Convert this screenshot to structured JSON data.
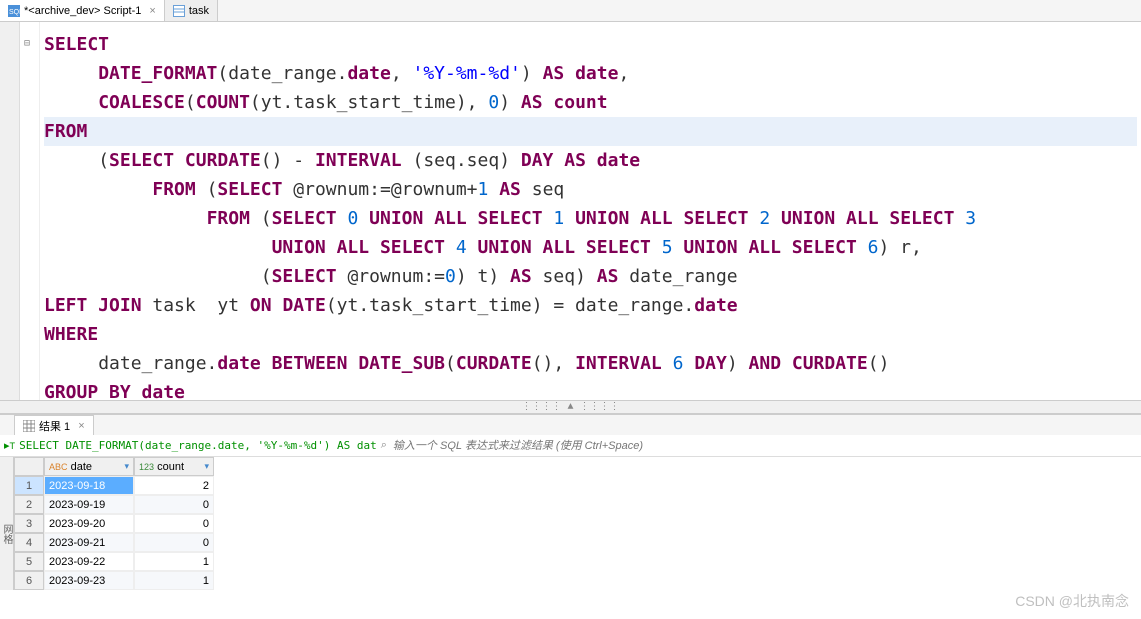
{
  "tabs": [
    {
      "label": "*<archive_dev> Script-1",
      "icon": "sql-icon",
      "active": true
    },
    {
      "label": "task",
      "icon": "table-icon",
      "active": false
    }
  ],
  "code": {
    "lines": [
      [
        {
          "c": "fold",
          "t": "⊟"
        },
        {
          "c": "kw",
          "t": "SELECT"
        }
      ],
      [
        {
          "c": "pad",
          "t": "     "
        },
        {
          "c": "kw",
          "t": "DATE_FORMAT"
        },
        {
          "c": "op",
          "t": "(date_range."
        },
        {
          "c": "kw",
          "t": "date"
        },
        {
          "c": "op",
          "t": ", "
        },
        {
          "c": "str",
          "t": "'%Y-%m-%d'"
        },
        {
          "c": "op",
          "t": ") "
        },
        {
          "c": "kw",
          "t": "AS"
        },
        {
          "c": "op",
          "t": " "
        },
        {
          "c": "kw",
          "t": "date"
        },
        {
          "c": "op",
          "t": ","
        }
      ],
      [
        {
          "c": "pad",
          "t": "     "
        },
        {
          "c": "kw",
          "t": "COALESCE"
        },
        {
          "c": "op",
          "t": "("
        },
        {
          "c": "kw",
          "t": "COUNT"
        },
        {
          "c": "op",
          "t": "(yt.task_start_time), "
        },
        {
          "c": "num",
          "t": "0"
        },
        {
          "c": "op",
          "t": ") "
        },
        {
          "c": "kw",
          "t": "AS"
        },
        {
          "c": "op",
          "t": " "
        },
        {
          "c": "kw",
          "t": "count"
        }
      ],
      [
        {
          "c": "kw",
          "t": "FROM"
        }
      ],
      [
        {
          "c": "pad",
          "t": "     "
        },
        {
          "c": "op",
          "t": "("
        },
        {
          "c": "kw",
          "t": "SELECT"
        },
        {
          "c": "op",
          "t": " "
        },
        {
          "c": "kw",
          "t": "CURDATE"
        },
        {
          "c": "op",
          "t": "() - "
        },
        {
          "c": "kw",
          "t": "INTERVAL"
        },
        {
          "c": "op",
          "t": " (seq.seq) "
        },
        {
          "c": "kw",
          "t": "DAY"
        },
        {
          "c": "op",
          "t": " "
        },
        {
          "c": "kw",
          "t": "AS"
        },
        {
          "c": "op",
          "t": " "
        },
        {
          "c": "kw",
          "t": "date"
        }
      ],
      [
        {
          "c": "pad",
          "t": "          "
        },
        {
          "c": "kw",
          "t": "FROM"
        },
        {
          "c": "op",
          "t": " ("
        },
        {
          "c": "kw",
          "t": "SELECT"
        },
        {
          "c": "op",
          "t": " @rownum:=@rownum+"
        },
        {
          "c": "num",
          "t": "1"
        },
        {
          "c": "op",
          "t": " "
        },
        {
          "c": "kw",
          "t": "AS"
        },
        {
          "c": "op",
          "t": " seq"
        }
      ],
      [
        {
          "c": "pad",
          "t": "               "
        },
        {
          "c": "kw",
          "t": "FROM"
        },
        {
          "c": "op",
          "t": " ("
        },
        {
          "c": "kw",
          "t": "SELECT"
        },
        {
          "c": "op",
          "t": " "
        },
        {
          "c": "num",
          "t": "0"
        },
        {
          "c": "op",
          "t": " "
        },
        {
          "c": "kw",
          "t": "UNION ALL SELECT"
        },
        {
          "c": "op",
          "t": " "
        },
        {
          "c": "num",
          "t": "1"
        },
        {
          "c": "op",
          "t": " "
        },
        {
          "c": "kw",
          "t": "UNION ALL SELECT"
        },
        {
          "c": "op",
          "t": " "
        },
        {
          "c": "num",
          "t": "2"
        },
        {
          "c": "op",
          "t": " "
        },
        {
          "c": "kw",
          "t": "UNION ALL SELECT"
        },
        {
          "c": "op",
          "t": " "
        },
        {
          "c": "num",
          "t": "3"
        }
      ],
      [
        {
          "c": "pad",
          "t": "                     "
        },
        {
          "c": "kw",
          "t": "UNION ALL SELECT"
        },
        {
          "c": "op",
          "t": " "
        },
        {
          "c": "num",
          "t": "4"
        },
        {
          "c": "op",
          "t": " "
        },
        {
          "c": "kw",
          "t": "UNION ALL SELECT"
        },
        {
          "c": "op",
          "t": " "
        },
        {
          "c": "num",
          "t": "5"
        },
        {
          "c": "op",
          "t": " "
        },
        {
          "c": "kw",
          "t": "UNION ALL SELECT"
        },
        {
          "c": "op",
          "t": " "
        },
        {
          "c": "num",
          "t": "6"
        },
        {
          "c": "op",
          "t": ") r,"
        }
      ],
      [
        {
          "c": "pad",
          "t": "                    "
        },
        {
          "c": "op",
          "t": "("
        },
        {
          "c": "kw",
          "t": "SELECT"
        },
        {
          "c": "op",
          "t": " @rownum:="
        },
        {
          "c": "num",
          "t": "0"
        },
        {
          "c": "op",
          "t": ") t) "
        },
        {
          "c": "kw",
          "t": "AS"
        },
        {
          "c": "op",
          "t": " seq) "
        },
        {
          "c": "kw",
          "t": "AS"
        },
        {
          "c": "op",
          "t": " date_range"
        }
      ],
      [
        {
          "c": "kw",
          "t": "LEFT JOIN"
        },
        {
          "c": "op",
          "t": " task  yt "
        },
        {
          "c": "kw",
          "t": "ON"
        },
        {
          "c": "op",
          "t": " "
        },
        {
          "c": "kw",
          "t": "DATE"
        },
        {
          "c": "op",
          "t": "(yt.task_start_time) = date_range."
        },
        {
          "c": "kw",
          "t": "date"
        }
      ],
      [
        {
          "c": "kw",
          "t": "WHERE"
        }
      ],
      [
        {
          "c": "pad",
          "t": "     "
        },
        {
          "c": "op",
          "t": "date_range."
        },
        {
          "c": "kw",
          "t": "date"
        },
        {
          "c": "op",
          "t": " "
        },
        {
          "c": "kw",
          "t": "BETWEEN"
        },
        {
          "c": "op",
          "t": " "
        },
        {
          "c": "kw",
          "t": "DATE_SUB"
        },
        {
          "c": "op",
          "t": "("
        },
        {
          "c": "kw",
          "t": "CURDATE"
        },
        {
          "c": "op",
          "t": "(), "
        },
        {
          "c": "kw",
          "t": "INTERVAL"
        },
        {
          "c": "op",
          "t": " "
        },
        {
          "c": "num",
          "t": "6"
        },
        {
          "c": "op",
          "t": " "
        },
        {
          "c": "kw",
          "t": "DAY"
        },
        {
          "c": "op",
          "t": ") "
        },
        {
          "c": "kw",
          "t": "AND"
        },
        {
          "c": "op",
          "t": " "
        },
        {
          "c": "kw",
          "t": "CURDATE"
        },
        {
          "c": "op",
          "t": "()"
        }
      ],
      [
        {
          "c": "kw",
          "t": "GROUP BY date"
        }
      ]
    ],
    "highlight_index": 3,
    "collapse_marker_row": 0
  },
  "splitter_handle": "⋮⋮⋮⋮ ▲ ⋮⋮⋮⋮",
  "results": {
    "tab_label": "结果 1",
    "query_snippet": "SELECT DATE_FORMAT(date_range.date, '%Y-%m-%d') AS dat",
    "filter_placeholder": "输入一个 SQL 表达式来过滤结果 (使用 Ctrl+Space)",
    "columns": [
      {
        "name": "date",
        "type_icon": "ABC"
      },
      {
        "name": "count",
        "type_icon": "123"
      }
    ],
    "rows": [
      {
        "n": 1,
        "date": "2023-09-18",
        "count": 2,
        "selected": true
      },
      {
        "n": 2,
        "date": "2023-09-19",
        "count": 0
      },
      {
        "n": 3,
        "date": "2023-09-20",
        "count": 0
      },
      {
        "n": 4,
        "date": "2023-09-21",
        "count": 0
      },
      {
        "n": 5,
        "date": "2023-09-22",
        "count": 1
      },
      {
        "n": 6,
        "date": "2023-09-23",
        "count": 1
      }
    ],
    "sidebar_label": "网格"
  },
  "watermark": "CSDN @北执南念"
}
